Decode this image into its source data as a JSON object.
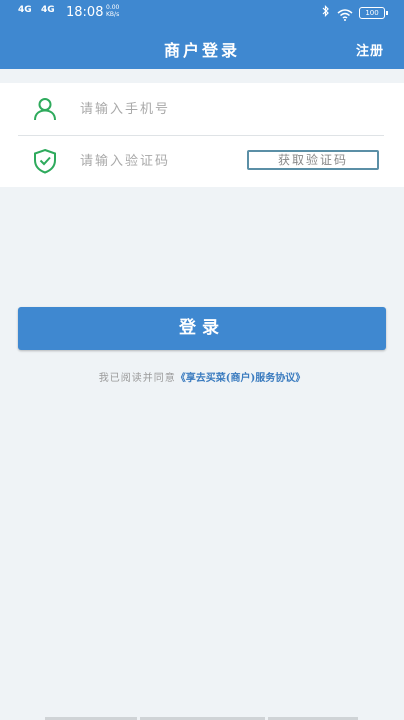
{
  "status_bar": {
    "network1": "4G",
    "network2": "4G",
    "time": "18:08",
    "speed_value": "0.00",
    "speed_unit": "KB/s",
    "battery": "100"
  },
  "header": {
    "title": "商户登录",
    "register_label": "注册"
  },
  "form": {
    "phone_placeholder": "请输入手机号",
    "code_placeholder": "请输入验证码",
    "get_code_label": "获取验证码"
  },
  "login_button_label": "登录",
  "agreement": {
    "prefix": "我已阅读并同意",
    "link": "《享去买菜(商户)服务协议》"
  },
  "icons": {
    "phone_field": "user-icon",
    "code_field": "shield-check-icon"
  },
  "colors": {
    "primary": "#3f88d0",
    "icon_green": "#2eaa5c",
    "link": "#3a7bbf",
    "background": "#eff3f6"
  }
}
